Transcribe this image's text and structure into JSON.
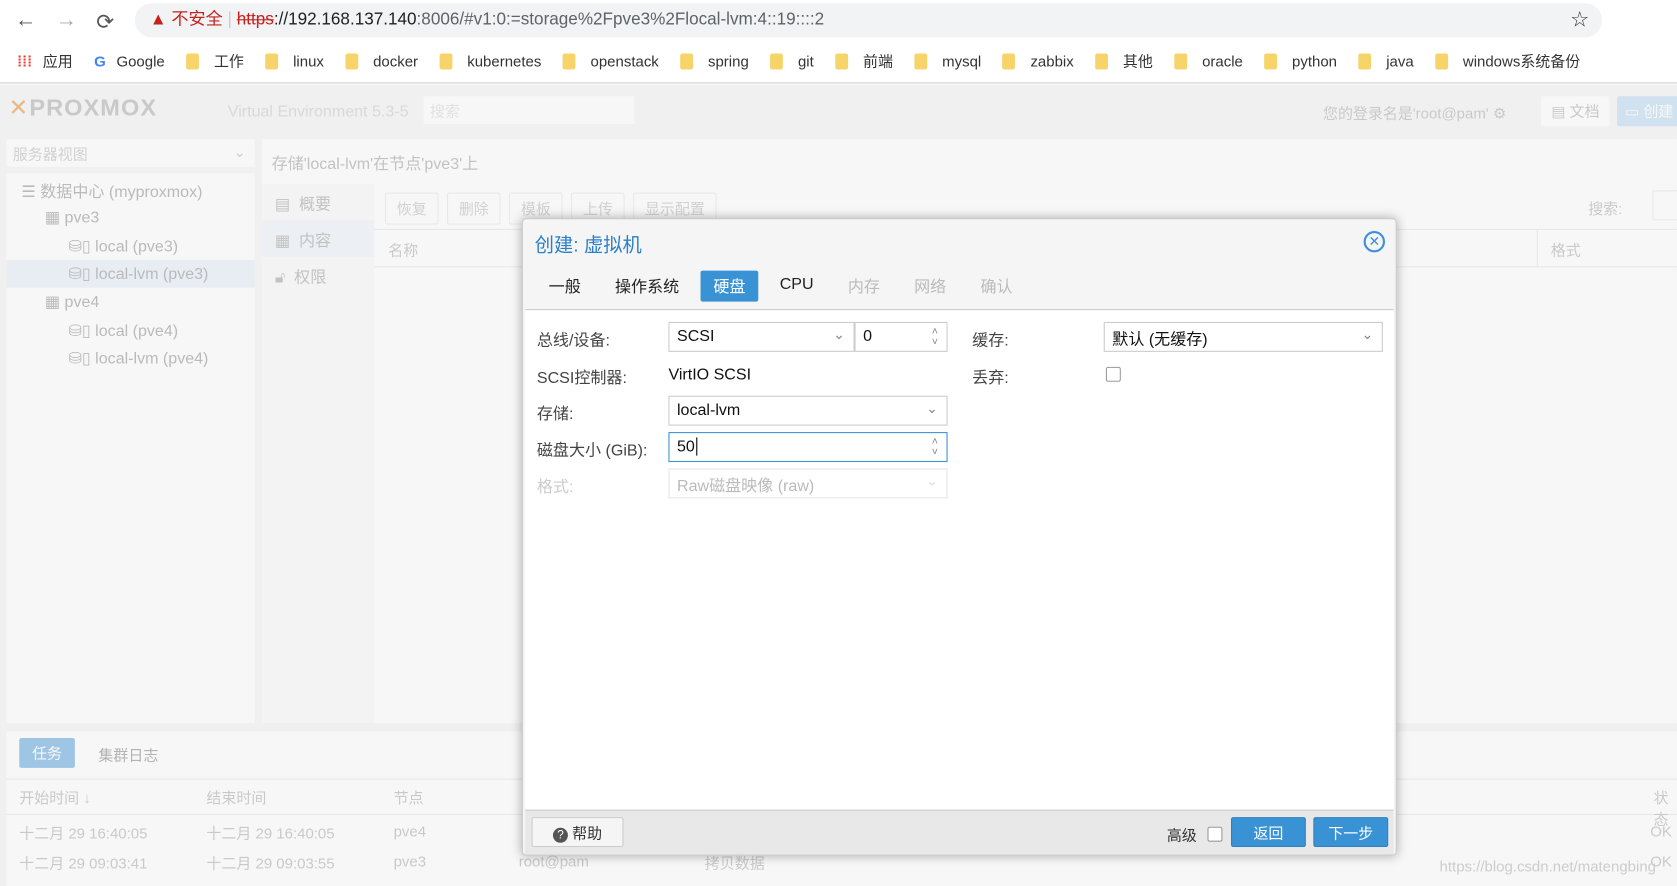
{
  "browser": {
    "back": "←",
    "forward": "→",
    "reload": "⟳",
    "insecure": "不安全",
    "url_scheme": "https",
    "url_host": "://192.168.137.140",
    "url_rest": ":8006/#v1:0:=storage%2Fpve3%2Flocal-lvm:4::19::::2",
    "star": "☆",
    "bookmarks": [
      "应用",
      "Google",
      "工作",
      "linux",
      "docker",
      "kubernetes",
      "openstack",
      "spring",
      "git",
      "前端",
      "mysql",
      "zabbix",
      "其他",
      "oracle",
      "python",
      "java",
      "windows系统备份"
    ]
  },
  "header": {
    "logo": "PROXMOX",
    "version": "Virtual Environment 5.3-5",
    "search_placeholder": "搜索",
    "login": "您的登录名是'root@pam'",
    "docs": "文档",
    "create": "创建"
  },
  "tree": {
    "view": "服务器视图",
    "items": [
      "数据中心 (myproxmox)",
      "pve3",
      "local (pve3)",
      "local-lvm (pve3)",
      "pve4",
      "local (pve4)",
      "local-lvm (pve4)"
    ]
  },
  "content": {
    "title": "存储'local-lvm'在节点'pve3'上",
    "nav": [
      "概要",
      "内容",
      "权限"
    ],
    "toolbar": [
      "恢复",
      "删除",
      "模板",
      "上传",
      "显示配置"
    ],
    "search_label": "搜索:",
    "cols": [
      "名称",
      "格式"
    ]
  },
  "dialog": {
    "title": "创建: 虚拟机",
    "tabs": [
      "一般",
      "操作系统",
      "硬盘",
      "CPU",
      "内存",
      "网络",
      "确认"
    ],
    "bus_label": "总线/设备:",
    "bus_value": "SCSI",
    "device_value": "0",
    "scsi_label": "SCSI控制器:",
    "scsi_value": "VirtIO SCSI",
    "storage_label": "存储:",
    "storage_value": "local-lvm",
    "size_label": "磁盘大小 (GiB):",
    "size_value": "50",
    "format_label": "格式:",
    "format_value": "Raw磁盘映像 (raw)",
    "cache_label": "缓存:",
    "cache_value": "默认 (无缓存)",
    "discard_label": "丢弃:",
    "help": "帮助",
    "advanced": "高级",
    "back": "返回",
    "next": "下一步"
  },
  "tasks": {
    "tabs": [
      "任务",
      "集群日志"
    ],
    "cols": [
      "开始时间 ↓",
      "结束时间",
      "节点",
      "状态"
    ],
    "rows": [
      [
        "十二月 29 16:40:05",
        "十二月 29 16:40:05",
        "pve4",
        "",
        "",
        "OK"
      ],
      [
        "十二月 29 09:03:41",
        "十二月 29 09:03:55",
        "pve3",
        "root@pam",
        "拷贝数据",
        "OK"
      ]
    ]
  },
  "watermark": "https://blog.csdn.net/matengbing"
}
